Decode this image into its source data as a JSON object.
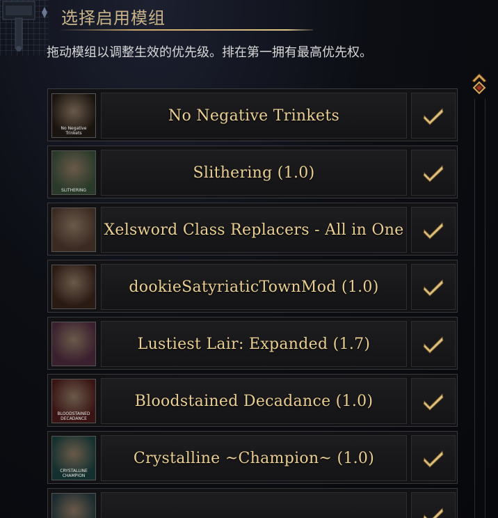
{
  "header": {
    "title": "选择启用模组",
    "subtitle": "拖动模组以调整生效的优先级。排在第一拥有最高优先权。"
  },
  "mods": [
    {
      "name": "No Negative Trinkets",
      "thumb_caption": "No Negative Trinkets",
      "enabled": true,
      "thumb_icon": "trinket-thumb-icon"
    },
    {
      "name": "Slithering (1.0)",
      "thumb_caption": "SLITHERING",
      "enabled": true,
      "thumb_icon": "slithering-thumb-icon"
    },
    {
      "name": "Xelsword Class Replacers - All in One",
      "thumb_caption": "",
      "enabled": true,
      "thumb_icon": "portrait-thumb-icon"
    },
    {
      "name": "dookieSatyriaticTownMod (1.0)",
      "thumb_caption": "",
      "enabled": true,
      "thumb_icon": "portrait-thumb-icon"
    },
    {
      "name": "Lustiest Lair: Expanded (1.7)",
      "thumb_caption": "",
      "enabled": true,
      "thumb_icon": "lair-thumb-icon"
    },
    {
      "name": "Bloodstained Decadance (1.0)",
      "thumb_caption": "BLOODSTAINED DECADANCE",
      "enabled": true,
      "thumb_icon": "bloodstained-thumb-icon"
    },
    {
      "name": "Crystalline ~Champion~ (1.0)",
      "thumb_caption": "CRYSTALLINE CHAMPION",
      "enabled": true,
      "thumb_icon": "crystalline-thumb-icon"
    },
    {
      "name": "",
      "thumb_caption": "",
      "enabled": true,
      "thumb_icon": "portrait-thumb-icon"
    }
  ],
  "colors": {
    "accent_gold": "#e9cf92",
    "title_gold": "#c9b48a",
    "panel_bg": "#121214"
  }
}
